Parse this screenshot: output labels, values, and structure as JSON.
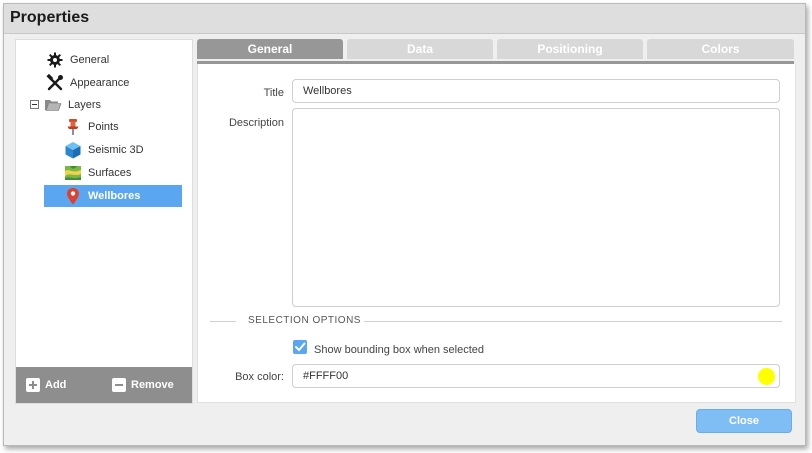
{
  "dialog": {
    "title": "Properties"
  },
  "tree": {
    "items": [
      {
        "label": "General",
        "icon": "gear-icon"
      },
      {
        "label": "Appearance",
        "icon": "tools-icon"
      },
      {
        "label": "Layers",
        "icon": "folder-open-icon",
        "expanded": true
      },
      {
        "label": "Points",
        "icon": "pushpin-icon"
      },
      {
        "label": "Seismic 3D",
        "icon": "cube-icon"
      },
      {
        "label": "Surfaces",
        "icon": "surface-map-icon"
      },
      {
        "label": "Wellbores",
        "icon": "map-marker-icon",
        "selected": true
      }
    ]
  },
  "sidebar_footer": {
    "add_label": "Add",
    "remove_label": "Remove"
  },
  "tabs": [
    {
      "label": "General",
      "active": true
    },
    {
      "label": "Data",
      "active": false
    },
    {
      "label": "Positioning",
      "active": false
    },
    {
      "label": "Colors",
      "active": false
    }
  ],
  "form": {
    "title_label": "Title",
    "title_value": "Wellbores",
    "description_label": "Description",
    "description_value": "",
    "section_title": "SELECTION OPTIONS",
    "bounding_box_label": "Show bounding box when selected",
    "bounding_box_checked": true,
    "box_color_label": "Box color:",
    "box_color_value": "#FFFF00"
  },
  "buttons": {
    "close_label": "Close"
  },
  "colors": {
    "selection": "#5aa6f0",
    "active_tab": "#979797",
    "inactive_tab": "#d8d8d8",
    "box_color_swatch": "#FFFF00"
  }
}
